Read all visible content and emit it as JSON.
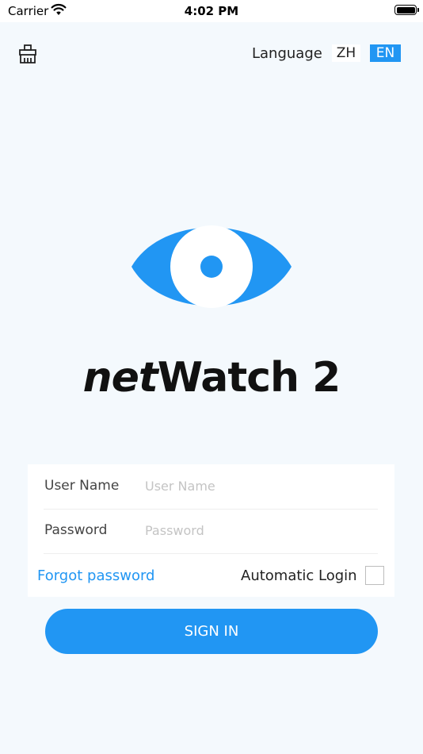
{
  "status_bar": {
    "carrier": "Carrier",
    "time": "4:02 PM"
  },
  "header": {
    "language_label": "Language",
    "lang_options": [
      "ZH",
      "EN"
    ],
    "selected_language": "EN"
  },
  "app": {
    "name_part1": "net",
    "name_part2": "Watch 2"
  },
  "form": {
    "username_label": "User Name",
    "username_placeholder": "User Name",
    "username_value": "",
    "password_label": "Password",
    "password_placeholder": "Password",
    "password_value": "",
    "forgot_label": "Forgot password",
    "auto_login_label": "Automatic Login",
    "auto_login_checked": false
  },
  "signin_label": "SIGN IN",
  "colors": {
    "accent": "#2196f3",
    "background": "#f4f9fd"
  }
}
